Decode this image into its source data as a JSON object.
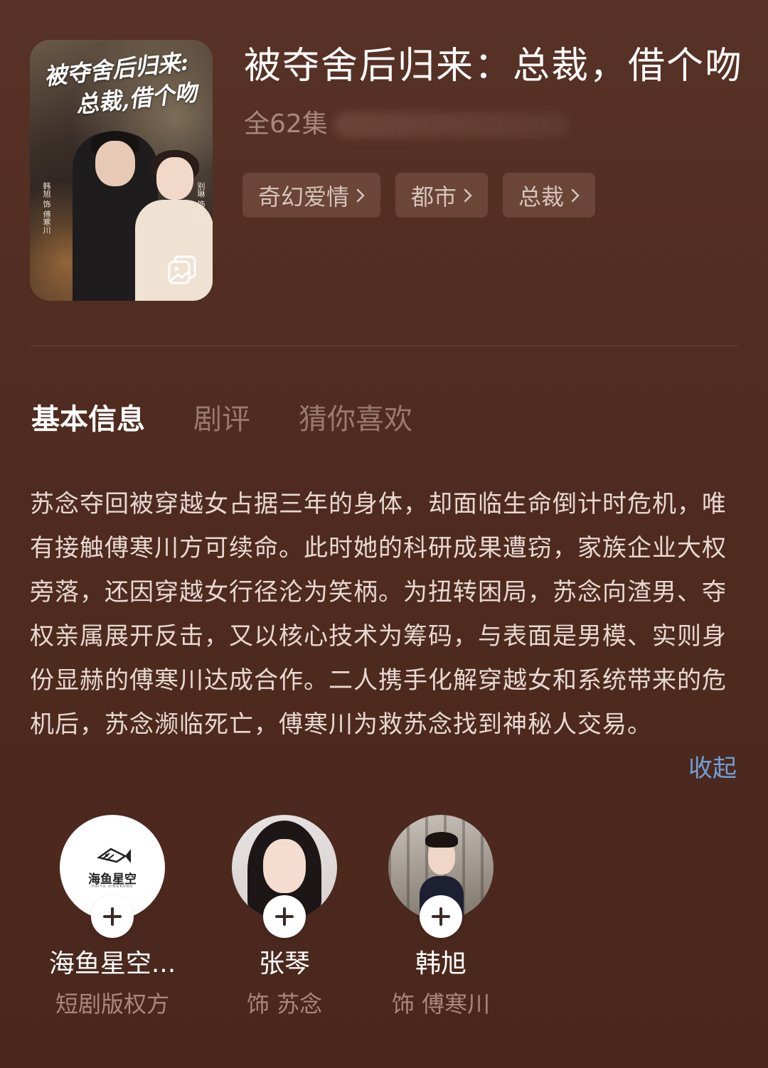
{
  "drama": {
    "title": "被夺舍后归来：总裁，借个吻",
    "episodes": "全62集",
    "poster": {
      "title_line1": "被夺舍后归来:",
      "title_line2": "总裁,借个吻",
      "credit_left": "韩旭 饰 傅寒川",
      "credit_right": "别琳 饰 苏念"
    },
    "tags": [
      {
        "label": "奇幻爱情"
      },
      {
        "label": "都市"
      },
      {
        "label": "总裁"
      }
    ]
  },
  "tabs": [
    {
      "label": "基本信息",
      "active": true
    },
    {
      "label": "剧评",
      "active": false
    },
    {
      "label": "猜你喜欢",
      "active": false
    }
  ],
  "synopsis": {
    "text": "苏念夺回被穿越女占据三年的身体，却面临生命倒计时危机，唯有接触傅寒川方可续命。此时她的科研成果遭窃，家族企业大权旁落，还因穿越女行径沦为笑柄。为扭转困局，苏念向渣男、夺权亲属展开反击，又以核心技术为筹码，与表面是男模、实则身份显赫的傅寒川达成合作。二人携手化解穿越女和系统带来的危机后，苏念濒临死亡，傅寒川为救苏念找到神秘人交易。",
    "collapse_label": "收起"
  },
  "people": [
    {
      "name": "海鱼星空...",
      "role": "短剧版权方",
      "logo_text": "海鱼星空",
      "logo_sub": "HAIYU XINGKONG"
    },
    {
      "name": "张琴",
      "role": "饰 苏念"
    },
    {
      "name": "韩旭",
      "role": "饰 傅寒川"
    }
  ],
  "icons": {
    "gallery": "gallery-icon",
    "chevron": "chevron-right-icon",
    "follow": "plus-icon"
  },
  "colors": {
    "background": "#4f2b20",
    "tag_bg": "#6a4538",
    "link": "#6f9fd8",
    "muted": "#a8887b"
  }
}
